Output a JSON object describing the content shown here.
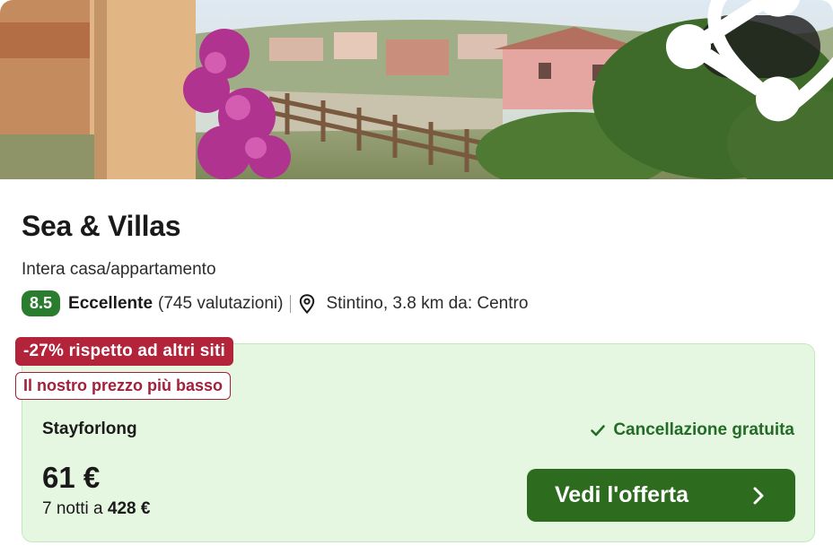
{
  "hero": {
    "image_alt": "",
    "share_icon": "share-icon",
    "favorite_icon": "heart-icon"
  },
  "listing": {
    "title": "Sea & Villas",
    "type": "Intera casa/appartamento",
    "score": "8.5",
    "rating_word": "Eccellente",
    "reviews": "(745 valutazioni)",
    "location": "Stintino, 3.8 km da: Centro",
    "location_icon": "map-pin-icon"
  },
  "offer": {
    "discount_badge": "-27% rispetto ad altri siti",
    "lowest_badge": "Il nostro prezzo più basso",
    "provider": "Stayforlong",
    "cancellation": "Cancellazione gratuita",
    "cancellation_icon": "check-icon",
    "price": "61 €",
    "nights_prefix": "7 notti a",
    "total": "428 €",
    "cta_label": "Vedi l'offerta",
    "cta_icon": "chevron-right-icon"
  },
  "colors": {
    "score_badge": "#2a7d2e",
    "discount_badge": "#b3243b",
    "offer_bg": "#e6f7e1",
    "cta_bg": "#2d6b1e",
    "cancel_text": "#236b27"
  }
}
